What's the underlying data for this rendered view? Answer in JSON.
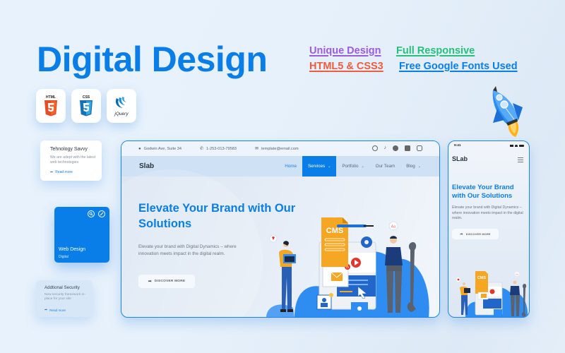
{
  "hero": {
    "title": "Digital Design",
    "features": [
      {
        "label": "Unique Design",
        "color": "#9b5ce0"
      },
      {
        "label": "Full Responsive",
        "color": "#27c07a"
      },
      {
        "label": "HTML5 & CSS3",
        "color": "#ee5c3c"
      },
      {
        "label": "Free Google Fonts Used",
        "color": "#0a7ee8"
      }
    ],
    "tech_badges": [
      {
        "name": "HTML",
        "icon": "html5-icon"
      },
      {
        "name": "CSS",
        "icon": "css3-icon"
      },
      {
        "name": "jQuery",
        "icon": "jquery-icon"
      }
    ]
  },
  "cards": {
    "tech_savvy": {
      "title": "Tehnology Savvy",
      "desc": "We are adept with the latest web technologies",
      "link": "Read more"
    },
    "web_design": {
      "title": "Web Design",
      "subtitle": "Digital"
    },
    "security": {
      "title": "Addtional Security",
      "desc": "New security framework in-place for your site",
      "link": "Read more"
    }
  },
  "desktop": {
    "topbar": {
      "address": "Godwin Ave, Suite 34",
      "phone": "1-253-013-79583",
      "email": "template@email.com",
      "social": [
        "pinterest-icon",
        "tiktok-icon",
        "facebook-icon",
        "linkedin-icon",
        "instagram-icon"
      ]
    },
    "nav": {
      "logo": "Slab",
      "links": [
        {
          "label": "Home",
          "state": "current"
        },
        {
          "label": "Services",
          "dropdown": true,
          "state": "active"
        },
        {
          "label": "Portfolio",
          "dropdown": true
        },
        {
          "label": "Our Team"
        },
        {
          "label": "Blog",
          "dropdown": true
        }
      ]
    },
    "hero": {
      "headline": "Elevate Your Brand with Our Solutions",
      "subtext": "Elevate your brand with Digital Dynamics – where innovation meets impact in the digital realm.",
      "cta": "DISCOVER MORE",
      "illustration_label": "CMS",
      "bubble_text": "Aa",
      "notification_count": "13"
    }
  },
  "mobile": {
    "time": "9:41",
    "logo": "SLab",
    "headline": "Elevate Your Brand with Our Solutions",
    "subtext": "Elevate your brand with Digital Dynamics – where innovation meets impact in the digital realm.",
    "cta": "DISCOVER MORE",
    "illustration_label": "CMS",
    "bubble_text": "Aa"
  }
}
